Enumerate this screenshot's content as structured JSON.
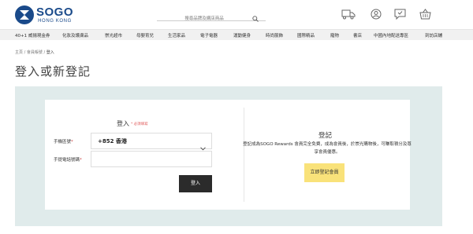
{
  "brand": {
    "name": "SOGO",
    "sub": "HONG KONG"
  },
  "search": {
    "placeholder": "搜尋品牌及網店商品"
  },
  "header_icons": [
    "truck-icon",
    "user-icon",
    "message-icon",
    "basket-icon"
  ],
  "nav": {
    "items": [
      "40+1 威揚現金券",
      "化妝及護膚品",
      "崇光超市",
      "母嬰育兒",
      "生活家品",
      "電子電器",
      "運動健身",
      "時尚服飾",
      "國際精品",
      "寵物",
      "書店",
      "中國內地配送專區",
      "到訪店舖"
    ]
  },
  "breadcrumb": {
    "home": "主頁",
    "sep": "/",
    "account": "會員帳號",
    "current": "登入"
  },
  "page": {
    "title": "登入或新登記"
  },
  "login": {
    "title": "登入",
    "required_note": "* 必須填寫",
    "region_label": "手機區號",
    "region_value": "+852 香港",
    "phone_label": "手提電話號碼",
    "phone_value": "",
    "submit_label": "登入"
  },
  "register": {
    "title": "登記",
    "description": "登記成為SOGO Rewards 會員完全免費，成為會員後，於崇光購物後，可賺取積分及尊享會員優惠。",
    "button_label": "立即登記會員"
  },
  "colors": {
    "brand": "#1a4a8a",
    "panel": "#e0ebeb",
    "login_button": "#2b2b2b",
    "register_button": "#f9e27a"
  }
}
